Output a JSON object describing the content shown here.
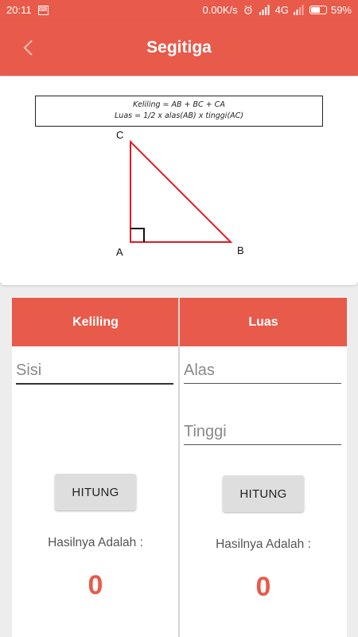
{
  "status_bar": {
    "time": "20:11",
    "notification_icon": "keyboard-notification-icon",
    "network_speed": "0.00K/s",
    "network_type": "4G",
    "battery_percent": "59%",
    "battery_level": 0.59
  },
  "app_bar": {
    "title": "Segitiga",
    "back_icon": "chevron-left-icon"
  },
  "formula": {
    "keliling": "Keliling = AB + BC + CA",
    "luas": "Luas  = 1/2 x alas(AB) x tinggi(AC)"
  },
  "triangle": {
    "label_a": "A",
    "label_b": "B",
    "label_c": "C"
  },
  "keliling_panel": {
    "header": "Keliling",
    "sisi_placeholder": "Sisi",
    "button_label": "HITUNG",
    "result_label": "Hasilnya Adalah :",
    "result_value": "0"
  },
  "luas_panel": {
    "header": "Luas",
    "alas_placeholder": "Alas",
    "tinggi_placeholder": "Tinggi",
    "button_label": "HITUNG",
    "result_label": "Hasilnya Adalah :",
    "result_value": "0"
  },
  "colors": {
    "primary": "#e85a4a",
    "triangle_stroke": "#e01b24"
  }
}
